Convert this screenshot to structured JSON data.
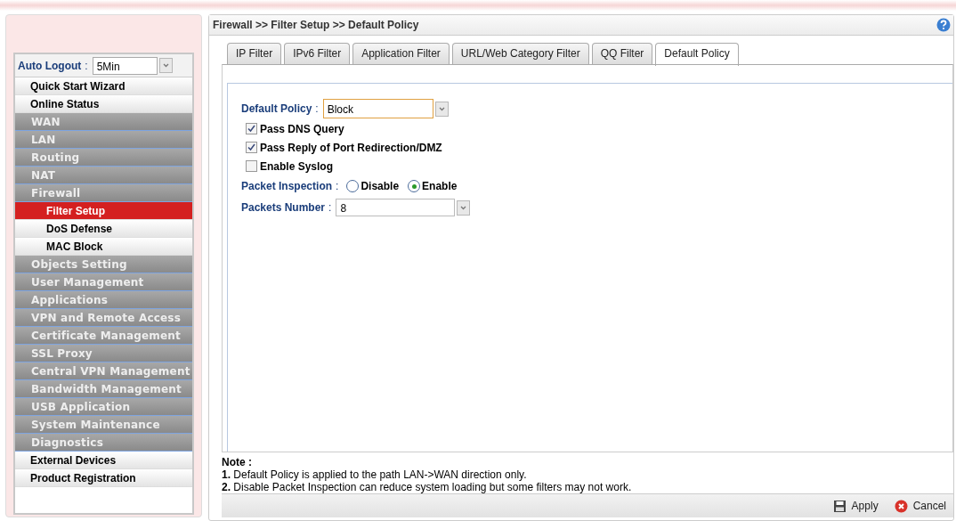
{
  "sidebar": {
    "auto_logout": {
      "label": "Auto Logout",
      "separator": ":",
      "value": "5Min"
    },
    "items": [
      {
        "label": "Quick Start Wizard",
        "kind": "plain",
        "selected": false
      },
      {
        "label": "Online Status",
        "kind": "plain",
        "selected": false
      },
      {
        "label": "WAN",
        "kind": "group",
        "selected": false
      },
      {
        "label": "LAN",
        "kind": "group",
        "selected": false
      },
      {
        "label": "Routing",
        "kind": "group",
        "selected": false
      },
      {
        "label": "NAT",
        "kind": "group",
        "selected": false
      },
      {
        "label": "Firewall",
        "kind": "group",
        "selected": false
      },
      {
        "label": "Filter Setup",
        "kind": "sub",
        "selected": true
      },
      {
        "label": "DoS Defense",
        "kind": "sub",
        "selected": false
      },
      {
        "label": "MAC Block",
        "kind": "sub",
        "selected": false
      },
      {
        "label": "Objects Setting",
        "kind": "group",
        "selected": false
      },
      {
        "label": "User Management",
        "kind": "group",
        "selected": false
      },
      {
        "label": "Applications",
        "kind": "group",
        "selected": false
      },
      {
        "label": "VPN and Remote Access",
        "kind": "group",
        "selected": false
      },
      {
        "label": "Certificate Management",
        "kind": "group",
        "selected": false
      },
      {
        "label": "SSL Proxy",
        "kind": "group",
        "selected": false
      },
      {
        "label": "Central VPN Management",
        "kind": "group",
        "selected": false
      },
      {
        "label": "Bandwidth Management",
        "kind": "group",
        "selected": false
      },
      {
        "label": "USB Application",
        "kind": "group",
        "selected": false
      },
      {
        "label": "System Maintenance",
        "kind": "group",
        "selected": false
      },
      {
        "label": "Diagnostics",
        "kind": "group",
        "selected": false
      },
      {
        "label": "External Devices",
        "kind": "plain",
        "selected": false
      },
      {
        "label": "Product Registration",
        "kind": "plain",
        "selected": false
      }
    ]
  },
  "breadcrumb": "Firewall >> Filter Setup >> Default Policy",
  "tabs": [
    {
      "label": "IP Filter",
      "selected": false
    },
    {
      "label": "IPv6 Filter",
      "selected": false
    },
    {
      "label": "Application Filter",
      "selected": false
    },
    {
      "label": "URL/Web Category Filter",
      "selected": false
    },
    {
      "label": "QQ Filter",
      "selected": false
    },
    {
      "label": "Default Policy",
      "selected": true
    }
  ],
  "form": {
    "default_policy": {
      "label": "Default Policy",
      "separator": ":",
      "value": "Block"
    },
    "checkboxes": [
      {
        "label": "Pass DNS Query",
        "checked": true
      },
      {
        "label": "Pass Reply of Port Redirection/DMZ",
        "checked": true
      },
      {
        "label": "Enable Syslog",
        "checked": false
      }
    ],
    "packet_inspection": {
      "label": "Packet Inspection",
      "separator": ":",
      "options": [
        {
          "label": "Disable",
          "selected": false
        },
        {
          "label": "Enable",
          "selected": true
        }
      ]
    },
    "packets_number": {
      "label": "Packets Number",
      "separator": ":",
      "value": "8"
    }
  },
  "note": {
    "title": "Note :",
    "lines": [
      "**1.** Default Policy is applied to the path LAN->WAN direction only.",
      "**2.** Disable Packet Inspection can reduce system loading but some filters may not work."
    ]
  },
  "buttons": [
    {
      "label": "Apply",
      "kind": "apply"
    },
    {
      "label": "Cancel",
      "kind": "cancel"
    }
  ]
}
